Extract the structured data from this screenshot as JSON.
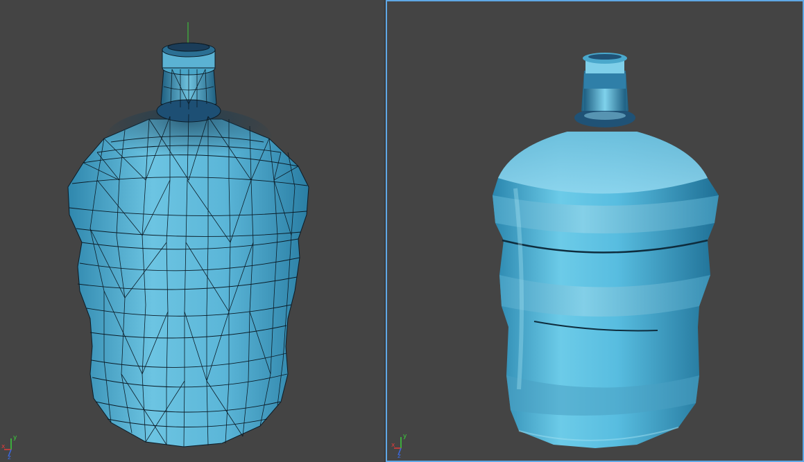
{
  "viewports": [
    {
      "id": "left",
      "shading": "wireframe-over-shaded",
      "active": false
    },
    {
      "id": "right",
      "shading": "smooth-shaded",
      "active": true
    }
  ],
  "colors": {
    "background": "#444444",
    "active_border": "#5fa8e6",
    "bottle_dark": "#1f6f92",
    "bottle_mid": "#3a9fc6",
    "bottle_light": "#7fd0ea",
    "wire": "#0b1b26",
    "axis_x": "#e23b3b",
    "axis_y": "#3bcf3b",
    "axis_z": "#3b6ae2"
  },
  "gizmo": {
    "labels": [
      "x",
      "y",
      "z"
    ],
    "icon": "axis-tripod-icon"
  }
}
